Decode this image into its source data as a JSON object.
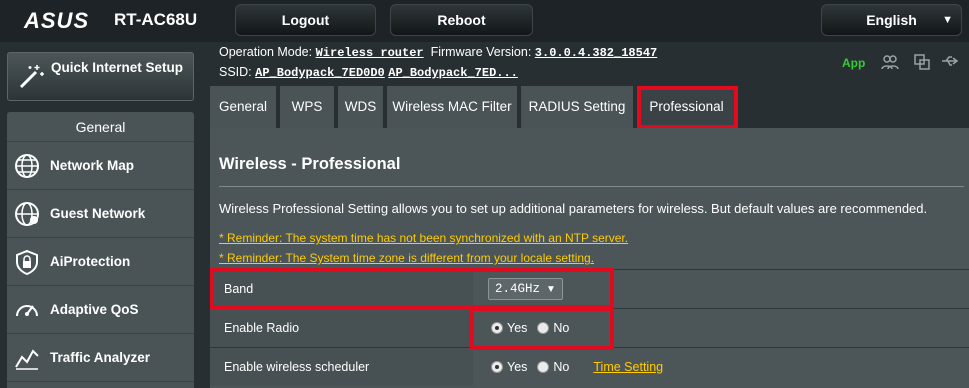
{
  "header": {
    "brand": "ASUS",
    "model": "RT-AC68U",
    "logout_label": "Logout",
    "reboot_label": "Reboot",
    "language": "English"
  },
  "status": {
    "op_mode_label": "Operation Mode:",
    "op_mode_value": "Wireless router",
    "firmware_label": "Firmware Version:",
    "firmware_value": "3.0.0.4.382_18547",
    "ssid_label": "SSID:",
    "ssid_1": "AP_Bodypack_7ED0D0",
    "ssid_2": "AP_Bodypack_7ED...",
    "app_label": "App"
  },
  "sidebar": {
    "qis_label": "Quick Internet Setup",
    "section_title": "General",
    "items": [
      {
        "label": "Network Map",
        "icon": "network-map-icon"
      },
      {
        "label": "Guest Network",
        "icon": "guest-network-icon"
      },
      {
        "label": "AiProtection",
        "icon": "aiprotection-lock-icon"
      },
      {
        "label": "Adaptive QoS",
        "icon": "gauge-icon"
      },
      {
        "label": "Traffic Analyzer",
        "icon": "traffic-chart-icon"
      }
    ]
  },
  "tabs": [
    {
      "label": "General"
    },
    {
      "label": "WPS"
    },
    {
      "label": "WDS"
    },
    {
      "label": "Wireless MAC Filter"
    },
    {
      "label": "RADIUS Setting"
    },
    {
      "label": "Professional",
      "active": true
    }
  ],
  "content": {
    "title": "Wireless - Professional",
    "description": "Wireless Professional Setting allows you to set up additional parameters for wireless. But default values are recommended.",
    "reminder_ntp": "* Reminder: The system time has not been synchronized with an NTP server.",
    "reminder_tz": "* Reminder: The System time zone is different from your locale setting.",
    "settings": {
      "band": {
        "label": "Band",
        "value": "2.4GHz"
      },
      "enable_radio": {
        "label": "Enable Radio",
        "yes": "Yes",
        "no": "No",
        "selected": "Yes"
      },
      "scheduler": {
        "label": "Enable wireless scheduler",
        "yes": "Yes",
        "no": "No",
        "selected": "Yes",
        "link": "Time Setting"
      }
    }
  },
  "colors": {
    "highlight": "#e10a1e",
    "reminder": "#ffcc00",
    "app_green": "#33cc33"
  }
}
